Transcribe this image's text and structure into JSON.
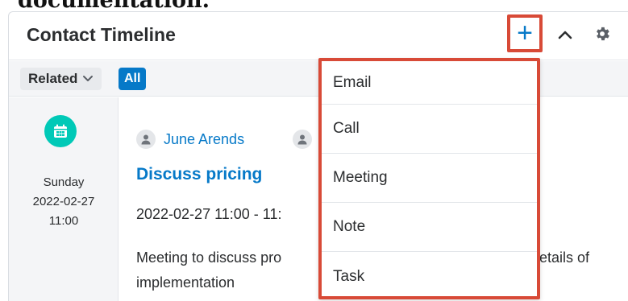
{
  "page_heading_fragment": "documentation.",
  "dashlet": {
    "title": "Contact Timeline",
    "add_label": "+",
    "collapse_icon": "chevron-up-icon",
    "settings_icon": "gear-icon"
  },
  "filters": {
    "related_label": "Related",
    "all_label": "All"
  },
  "event": {
    "day": "Sunday",
    "date": "2022-02-27",
    "time": "11:00",
    "person": "June Arends",
    "title": "Discuss pricing",
    "time_range": "2022-02-27 11:00 - 11:",
    "description_line1_start": "Meeting to discuss pro",
    "description_line1_end": "etails of",
    "description_line2": "implementation"
  },
  "menu": {
    "items": [
      "Email",
      "Call",
      "Meeting",
      "Note",
      "Task"
    ]
  },
  "colors": {
    "accent": "#0679c8",
    "highlight": "#d84a37",
    "calendar": "#00c9b7"
  }
}
